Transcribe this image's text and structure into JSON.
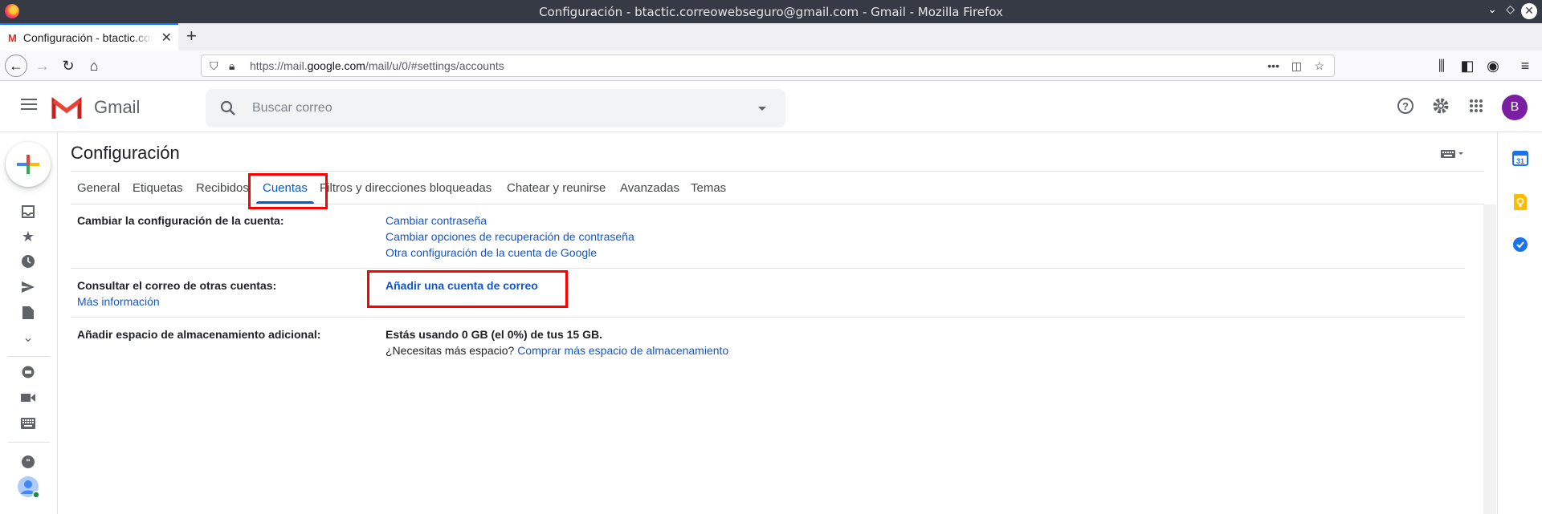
{
  "window": {
    "title": "Configuración - btactic.correowebseguro@gmail.com - Gmail - Mozilla Firefox"
  },
  "browser": {
    "tab_title": "Configuración - btactic.correowebseguro@gmail.com - Gmail",
    "tab_favicon": "M",
    "url_prefix": "https://mail.",
    "url_domain": "google.com",
    "url_path": "/mail/u/0/#settings/accounts"
  },
  "gmail": {
    "brand": "Gmail",
    "search_placeholder": "Buscar correo",
    "avatar_letter": "B"
  },
  "settings": {
    "title": "Configuración",
    "tabs": [
      {
        "label": "General"
      },
      {
        "label": "Etiquetas"
      },
      {
        "label": "Recibidos"
      },
      {
        "label": "Cuentas"
      },
      {
        "label": "Filtros y direcciones bloqueadas"
      },
      {
        "label": "Chatear y reunirse"
      },
      {
        "label": "Avanzadas"
      },
      {
        "label": "Temas"
      }
    ],
    "active_tab": "Cuentas",
    "account_settings": {
      "label": "Cambiar la configuración de la cuenta:",
      "links": [
        "Cambiar contraseña",
        "Cambiar opciones de recuperación de contraseña",
        "Otra configuración de la cuenta de Google"
      ]
    },
    "other_accounts": {
      "label": "Consultar el correo de otras cuentas:",
      "more_info": "Más información",
      "add_link": "Añadir una cuenta de correo"
    },
    "storage": {
      "label": "Añadir espacio de almacenamiento adicional:",
      "usage": "Estás usando 0 GB (el 0%) de tus 15 GB.",
      "question": "¿Necesitas más espacio?",
      "buy_link": "Comprar más espacio de almacenamiento"
    }
  },
  "colors": {
    "link": "#1155cc",
    "active_tab": "#0b57d0",
    "highlight": "#ff0000"
  }
}
